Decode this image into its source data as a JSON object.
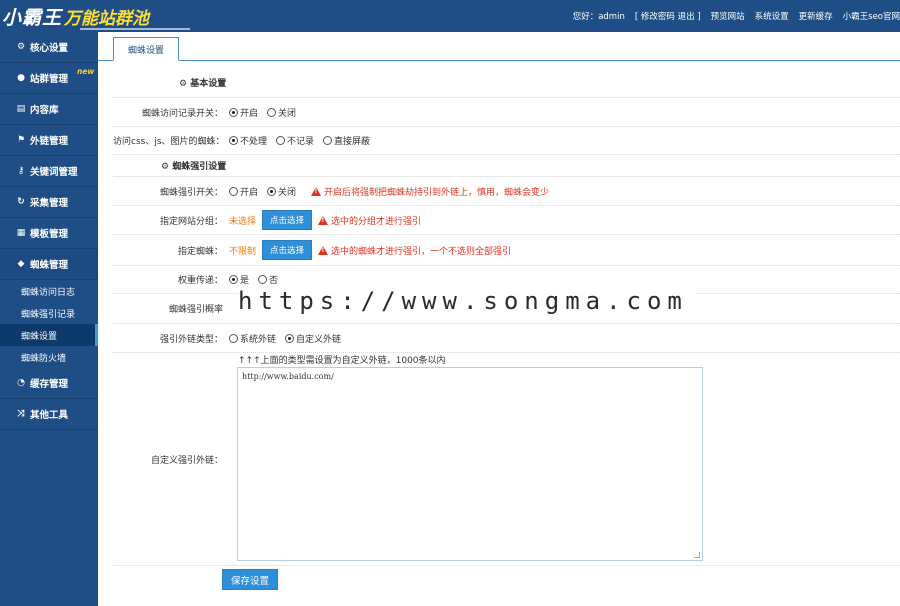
{
  "header": {
    "logo_main": "小霸王",
    "logo_sub": "万能站群池",
    "greeting": "您好：admin",
    "change_logout": "[ 修改密码 退出 ]",
    "preview": "预览网站",
    "settings": "系统设置",
    "update_cache": "更新缓存",
    "official": "小霸王seo官网"
  },
  "sidebar": {
    "items": [
      {
        "label": "核心设置",
        "icon": "gear-icon",
        "glyph": "⚙"
      },
      {
        "label": "站群管理",
        "icon": "user-icon",
        "glyph": "●",
        "badge": "new"
      },
      {
        "label": "内容库",
        "icon": "document-icon",
        "glyph": "▤"
      },
      {
        "label": "外链管理",
        "icon": "link-icon",
        "glyph": "⚑"
      },
      {
        "label": "关键词管理",
        "icon": "key-icon",
        "glyph": "⚷"
      },
      {
        "label": "采集管理",
        "icon": "refresh-icon",
        "glyph": "↻"
      },
      {
        "label": "模板管理",
        "icon": "windows-icon",
        "glyph": "▦"
      },
      {
        "label": "蜘蛛管理",
        "icon": "android-icon",
        "glyph": "◆"
      }
    ],
    "sub_items": [
      {
        "label": "蜘蛛访问日志"
      },
      {
        "label": "蜘蛛强引记录"
      },
      {
        "label": "蜘蛛设置"
      },
      {
        "label": "蜘蛛防火墙"
      }
    ],
    "after_items": [
      {
        "label": "缓存管理",
        "icon": "dashboard-icon",
        "glyph": "◔"
      },
      {
        "label": "其他工具",
        "icon": "shuffle-icon",
        "glyph": "⤨"
      }
    ]
  },
  "main": {
    "tab": "蜘蛛设置",
    "section_basic": "基本设置",
    "row_log": {
      "label": "蜘蛛访问记录开关：",
      "on": "开启",
      "off": "关闭"
    },
    "row_css": {
      "label": "访问css、js、图片的蜘蛛：",
      "o1": "不处理",
      "o2": "不记录",
      "o3": "直接屏蔽"
    },
    "section_force": "蜘蛛强引设置",
    "row_force": {
      "label": "蜘蛛强引开关：",
      "on": "开启",
      "off": "关闭",
      "warn": "开启后将强制把蜘蛛劫持引到外链上，慎用，蜘蛛会变少"
    },
    "row_group": {
      "label": "指定网站分组：",
      "value": "未选择",
      "button": "点击选择",
      "warn": "选中的分组才进行强引"
    },
    "row_spider": {
      "label": "指定蜘蛛：",
      "value": "不限制",
      "button": "点击选择",
      "warn": "选中的蜘蛛才进行强引，一个不选则全部强引"
    },
    "row_weight": {
      "label": "权重传递：",
      "yes": "是",
      "no": "否"
    },
    "row_prob": {
      "label": "蜘蛛强引概率"
    },
    "row_type": {
      "label": "强引外链类型：",
      "o1": "系统外链",
      "o2": "自定义外链"
    },
    "row_custom": {
      "label": "自定义强引外链：",
      "note": "↑↑↑上面的类型需设置为自定义外链，1000条以内",
      "value": "http://www.baidu.com/"
    },
    "save": "保存设置",
    "watermark": "https://www.songma.com"
  }
}
